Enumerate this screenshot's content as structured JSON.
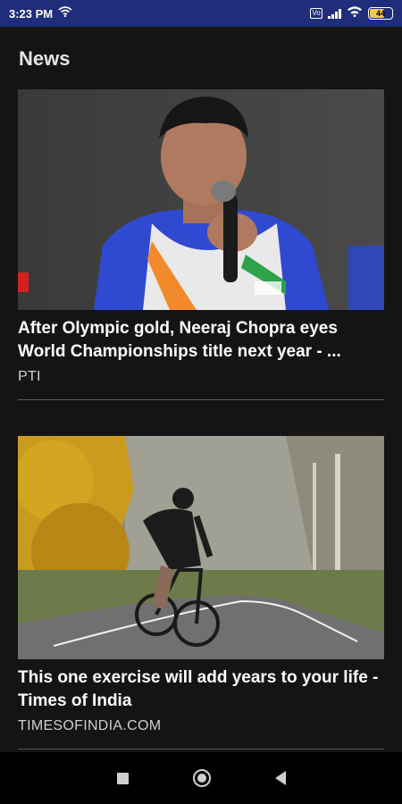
{
  "status_bar": {
    "time": "3:23 PM",
    "sim_label": "Vo",
    "battery_level": "44",
    "icons": [
      "wifi-status-icon",
      "sim-icon",
      "signal-icon",
      "wifi-icon",
      "battery-icon"
    ]
  },
  "header": {
    "title": "News"
  },
  "articles": [
    {
      "title": "After Olympic gold, Neeraj Chopra eyes World Championships title next year - ...",
      "source": "PTI",
      "image": "athlete-with-microphone"
    },
    {
      "title": "This one exercise will add years to your life - Times of India",
      "source": "TIMESOFINDIA.COM",
      "image": "cyclist-on-road"
    }
  ],
  "nav_bar": {
    "icons": [
      "recents-square-icon",
      "home-circle-icon",
      "back-triangle-icon"
    ]
  },
  "colors": {
    "status_bar": "#1f2d7a",
    "background": "#141414",
    "nav_bar": "#000000"
  }
}
